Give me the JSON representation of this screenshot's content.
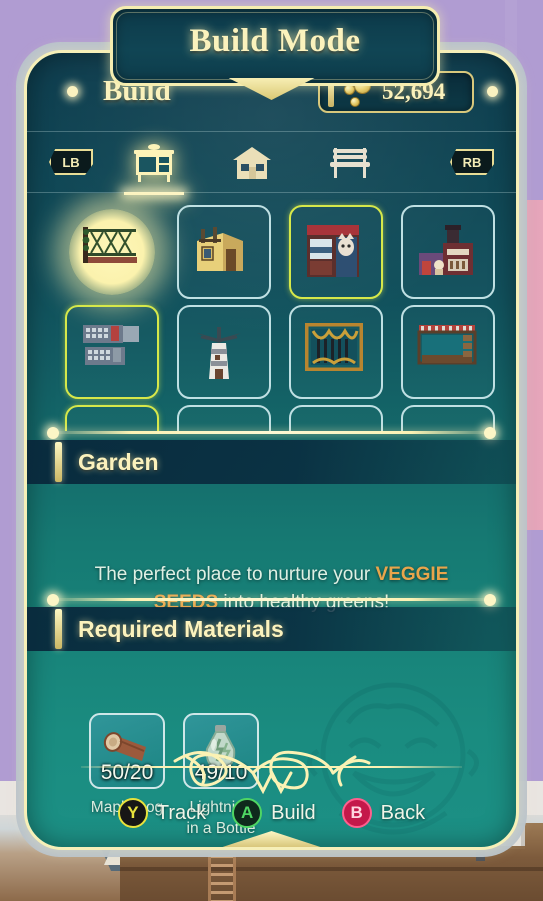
{
  "banner": {
    "title": "Build Mode"
  },
  "header": {
    "menu_title": "Build",
    "currency_value": "52,694",
    "currency_icon": "coin-cluster-icon"
  },
  "tabbar": {
    "left_bumper": "LB",
    "right_bumper": "RB",
    "tabs": [
      {
        "id": "furniture",
        "icon": "dresser-icon",
        "active": true
      },
      {
        "id": "houses",
        "icon": "house-icon",
        "active": false
      },
      {
        "id": "outdoor",
        "icon": "bench-icon",
        "active": false
      }
    ]
  },
  "grid": {
    "items": [
      {
        "id": "garden",
        "icon": "garden-fence-icon",
        "state": "highlighted"
      },
      {
        "id": "yellow-house",
        "icon": "yellow-house-icon",
        "state": "normal"
      },
      {
        "id": "red-shop",
        "icon": "red-shop-icon",
        "state": "selected"
      },
      {
        "id": "purple-store",
        "icon": "purple-store-icon",
        "state": "normal"
      },
      {
        "id": "market-stalls",
        "icon": "market-stalls-icon",
        "state": "selected"
      },
      {
        "id": "lighthouse",
        "icon": "lighthouse-icon",
        "state": "normal"
      },
      {
        "id": "gold-gate",
        "icon": "gold-gate-icon",
        "state": "normal"
      },
      {
        "id": "awning-stand",
        "icon": "awning-stand-icon",
        "state": "normal"
      }
    ]
  },
  "detail": {
    "name": "Garden",
    "description_before": "The perfect place to nurture your ",
    "description_highlight": "VEGGIE SEEDS",
    "description_after": " into healthy greens!"
  },
  "materials": {
    "heading": "Required Materials",
    "items": [
      {
        "id": "maple-log",
        "icon": "log-icon",
        "count": "50/20",
        "name": "Maple Log"
      },
      {
        "id": "lightning-in-a-bottle",
        "icon": "bottle-icon",
        "count": "49/10",
        "name": "Lightning in a Bottle"
      }
    ]
  },
  "footer": {
    "actions": [
      {
        "glyph": "Y",
        "label": "Track",
        "color": "#e8e23c"
      },
      {
        "glyph": "A",
        "label": "Build",
        "color": "#4fd663"
      },
      {
        "glyph": "B",
        "label": "Back",
        "color": "#ff5f8e"
      }
    ]
  },
  "colors": {
    "panel_gold": "#f6efb8",
    "panel_teal_top": "#0e3c4d",
    "panel_teal_bottom": "#1c9085",
    "highlight_orange": "#e8a54b",
    "selection_green": "#d6e84a",
    "background_purple": "#b09cd2"
  }
}
